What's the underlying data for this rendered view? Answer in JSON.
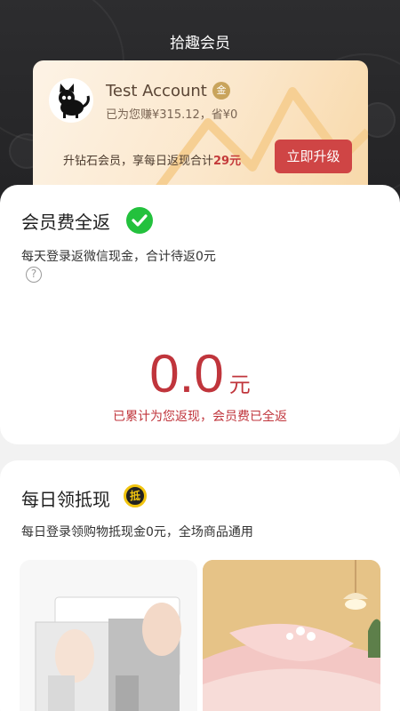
{
  "header": {
    "title": "拾趣会员"
  },
  "member": {
    "name": "Test Account",
    "tier_badge": "金",
    "earned_text": "已为您赚¥315.12，省¥0",
    "upgrade_prefix": "升钻石会员，享每日返现合计",
    "upgrade_amount": "29元",
    "upgrade_button": "立即升级"
  },
  "refund": {
    "title": "会员费全返",
    "subtitle": "每天登录返微信现金，合计待返0元",
    "help": "?",
    "amount": "0.0",
    "unit": "元",
    "note": "已累计为您返现，会员费已全返"
  },
  "daily": {
    "title": "每日领抵现",
    "badge": "抵",
    "subtitle": "每日登录领购物抵现金0元，全场商品通用"
  },
  "products": [
    {
      "name": "mask-product"
    },
    {
      "name": "bedding-product"
    }
  ],
  "colors": {
    "accent_red": "#cf4545",
    "amount_red": "#c0353c",
    "check_green": "#23c13d",
    "gold": "#c9a45c"
  }
}
